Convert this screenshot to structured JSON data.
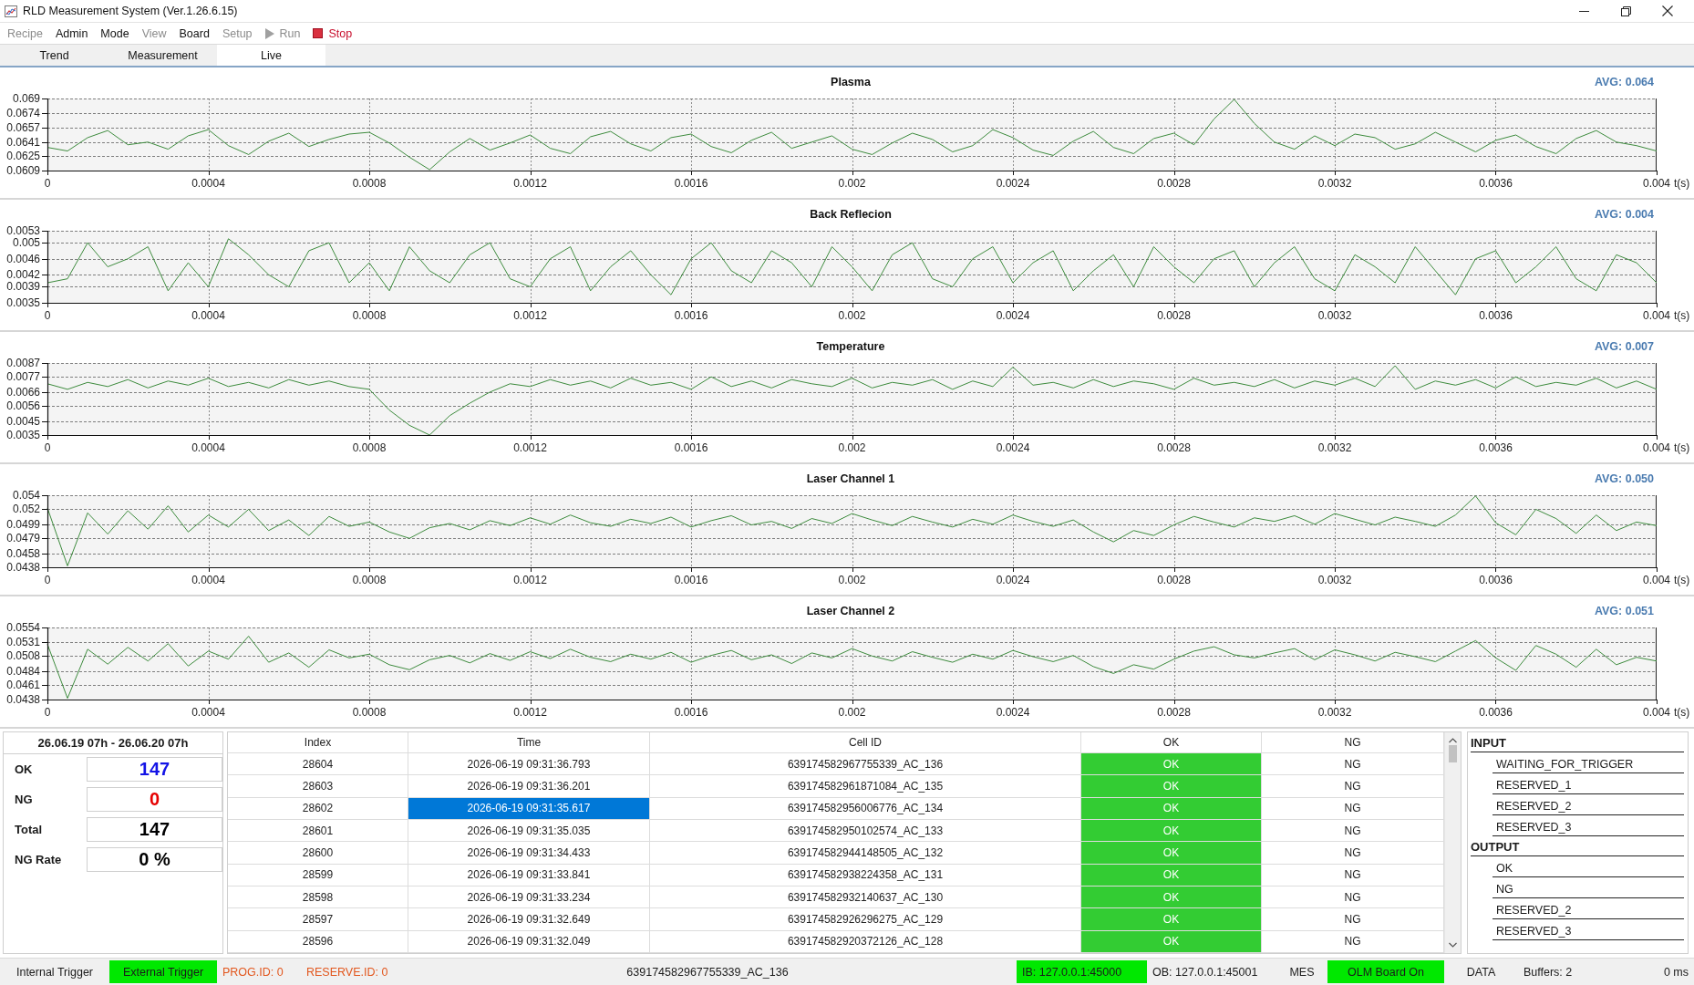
{
  "window": {
    "title": "RLD Measurement System (Ver.1.26.6.15)"
  },
  "menu": [
    {
      "label": "Recipe",
      "kind": "plain",
      "disabled": true
    },
    {
      "label": "Admin",
      "kind": "plain",
      "disabled": false
    },
    {
      "label": "Mode",
      "kind": "plain",
      "disabled": false
    },
    {
      "label": "View",
      "kind": "plain",
      "disabled": true
    },
    {
      "label": "Board",
      "kind": "plain",
      "disabled": false
    },
    {
      "label": "Setup",
      "kind": "plain",
      "disabled": true
    },
    {
      "label": "Run",
      "kind": "run",
      "disabled": true
    },
    {
      "label": "Stop",
      "kind": "stop",
      "disabled": false
    }
  ],
  "tabs": [
    {
      "label": "Trend",
      "selected": false
    },
    {
      "label": "Measurement",
      "selected": false
    },
    {
      "label": "Live",
      "selected": true
    }
  ],
  "charts": [
    {
      "average": "AVG: 0.064",
      "chart_data": {
        "type": "line",
        "title": "Plasma",
        "xlabel": "t(s)",
        "grid": true,
        "x": [
          0,
          5e-05,
          0.0001,
          0.00015,
          0.0002,
          0.00025,
          0.0003,
          0.00035,
          0.0004,
          0.00045,
          0.0005,
          0.00055,
          0.0006,
          0.00065,
          0.0007,
          0.00075,
          0.0008,
          0.00085,
          0.0009,
          0.00095,
          0.001,
          0.00105,
          0.0011,
          0.00115,
          0.0012,
          0.00125,
          0.0013,
          0.00135,
          0.0014,
          0.00145,
          0.0015,
          0.00155,
          0.0016,
          0.00165,
          0.0017,
          0.00175,
          0.0018,
          0.00185,
          0.0019,
          0.00195,
          0.002,
          0.00205,
          0.0021,
          0.00215,
          0.0022,
          0.00225,
          0.0023,
          0.00235,
          0.0024,
          0.00245,
          0.0025,
          0.00255,
          0.0026,
          0.00265,
          0.0027,
          0.00275,
          0.0028,
          0.00285,
          0.0029,
          0.00295,
          0.003,
          0.00305,
          0.0031,
          0.00315,
          0.0032,
          0.00325,
          0.0033,
          0.00335,
          0.0034,
          0.00345,
          0.0035,
          0.00355,
          0.0036,
          0.00365,
          0.0037,
          0.00375,
          0.0038,
          0.00385,
          0.0039,
          0.00395,
          0.004
        ],
        "values": [
          0.0635,
          0.0631,
          0.0646,
          0.0654,
          0.0638,
          0.0641,
          0.0633,
          0.0648,
          0.0655,
          0.0637,
          0.0627,
          0.0642,
          0.0651,
          0.0636,
          0.0644,
          0.065,
          0.0652,
          0.064,
          0.0624,
          0.061,
          0.063,
          0.0645,
          0.0632,
          0.064,
          0.0649,
          0.0634,
          0.0628,
          0.0647,
          0.0653,
          0.0639,
          0.0631,
          0.0646,
          0.065,
          0.0636,
          0.0629,
          0.0643,
          0.0652,
          0.0634,
          0.0641,
          0.0648,
          0.0633,
          0.0627,
          0.064,
          0.0651,
          0.0644,
          0.063,
          0.0637,
          0.0655,
          0.0646,
          0.0632,
          0.0626,
          0.0642,
          0.0653,
          0.0635,
          0.0628,
          0.0645,
          0.0651,
          0.0638,
          0.0667,
          0.0689,
          0.0662,
          0.0641,
          0.0633,
          0.0648,
          0.0637,
          0.065,
          0.0646,
          0.0633,
          0.0639,
          0.0652,
          0.0641,
          0.063,
          0.0643,
          0.0649,
          0.0636,
          0.0628,
          0.0645,
          0.0654,
          0.0641,
          0.0637,
          0.0631
        ],
        "xlim": [
          0,
          0.004
        ],
        "ylim": [
          0.0609,
          0.069
        ],
        "xticks": [
          0,
          0.0004,
          0.0008,
          0.0012,
          0.0016,
          0.002,
          0.0024,
          0.0028,
          0.0032,
          0.0036,
          0.004
        ],
        "yticks": [
          0.0609,
          0.0625,
          0.0641,
          0.0657,
          0.0674,
          0.069
        ]
      }
    },
    {
      "average": "AVG: 0.004",
      "chart_data": {
        "type": "line",
        "title": "Back Reflecion",
        "xlabel": "t(s)",
        "grid": true,
        "x": [
          0,
          5e-05,
          0.0001,
          0.00015,
          0.0002,
          0.00025,
          0.0003,
          0.00035,
          0.0004,
          0.00045,
          0.0005,
          0.00055,
          0.0006,
          0.00065,
          0.0007,
          0.00075,
          0.0008,
          0.00085,
          0.0009,
          0.00095,
          0.001,
          0.00105,
          0.0011,
          0.00115,
          0.0012,
          0.00125,
          0.0013,
          0.00135,
          0.0014,
          0.00145,
          0.0015,
          0.00155,
          0.0016,
          0.00165,
          0.0017,
          0.00175,
          0.0018,
          0.00185,
          0.0019,
          0.00195,
          0.002,
          0.00205,
          0.0021,
          0.00215,
          0.0022,
          0.00225,
          0.0023,
          0.00235,
          0.0024,
          0.00245,
          0.0025,
          0.00255,
          0.0026,
          0.00265,
          0.0027,
          0.00275,
          0.0028,
          0.00285,
          0.0029,
          0.00295,
          0.003,
          0.00305,
          0.0031,
          0.00315,
          0.0032,
          0.00325,
          0.0033,
          0.00335,
          0.0034,
          0.00345,
          0.0035,
          0.00355,
          0.0036,
          0.00365,
          0.0037,
          0.00375,
          0.0038,
          0.00385,
          0.0039,
          0.00395,
          0.004
        ],
        "values": [
          0.004,
          0.0041,
          0.005,
          0.0044,
          0.0046,
          0.0049,
          0.0038,
          0.0045,
          0.0039,
          0.0051,
          0.0047,
          0.0042,
          0.0039,
          0.0048,
          0.005,
          0.004,
          0.0045,
          0.0038,
          0.0049,
          0.0043,
          0.004,
          0.0047,
          0.005,
          0.0041,
          0.0039,
          0.0046,
          0.0049,
          0.0038,
          0.0044,
          0.0048,
          0.0042,
          0.0037,
          0.0046,
          0.005,
          0.0043,
          0.004,
          0.0048,
          0.0045,
          0.0039,
          0.0049,
          0.0044,
          0.0038,
          0.0047,
          0.005,
          0.0041,
          0.0039,
          0.0046,
          0.0049,
          0.004,
          0.0045,
          0.0048,
          0.0038,
          0.0043,
          0.0047,
          0.0039,
          0.0049,
          0.0044,
          0.004,
          0.0046,
          0.0048,
          0.0039,
          0.0045,
          0.0049,
          0.0041,
          0.0038,
          0.0047,
          0.0044,
          0.004,
          0.0049,
          0.0043,
          0.0037,
          0.0046,
          0.0048,
          0.004,
          0.0044,
          0.0049,
          0.0041,
          0.0038,
          0.0047,
          0.0045,
          0.004
        ],
        "xlim": [
          0,
          0.004
        ],
        "ylim": [
          0.0035,
          0.0053
        ],
        "xticks": [
          0,
          0.0004,
          0.0008,
          0.0012,
          0.0016,
          0.002,
          0.0024,
          0.0028,
          0.0032,
          0.0036,
          0.004
        ],
        "yticks": [
          0.0035,
          0.0039,
          0.0042,
          0.0046,
          0.005,
          0.0053
        ]
      }
    },
    {
      "average": "AVG: 0.007",
      "chart_data": {
        "type": "line",
        "title": "Temperature",
        "xlabel": "t(s)",
        "grid": true,
        "x": [
          0,
          5e-05,
          0.0001,
          0.00015,
          0.0002,
          0.00025,
          0.0003,
          0.00035,
          0.0004,
          0.00045,
          0.0005,
          0.00055,
          0.0006,
          0.00065,
          0.0007,
          0.00075,
          0.0008,
          0.00085,
          0.0009,
          0.00095,
          0.001,
          0.00105,
          0.0011,
          0.00115,
          0.0012,
          0.00125,
          0.0013,
          0.00135,
          0.0014,
          0.00145,
          0.0015,
          0.00155,
          0.0016,
          0.00165,
          0.0017,
          0.00175,
          0.0018,
          0.00185,
          0.0019,
          0.00195,
          0.002,
          0.00205,
          0.0021,
          0.00215,
          0.0022,
          0.00225,
          0.0023,
          0.00235,
          0.0024,
          0.00245,
          0.0025,
          0.00255,
          0.0026,
          0.00265,
          0.0027,
          0.00275,
          0.0028,
          0.00285,
          0.0029,
          0.00295,
          0.003,
          0.00305,
          0.0031,
          0.00315,
          0.0032,
          0.00325,
          0.0033,
          0.00335,
          0.0034,
          0.00345,
          0.0035,
          0.00355,
          0.0036,
          0.00365,
          0.0037,
          0.00375,
          0.0038,
          0.00385,
          0.0039,
          0.00395,
          0.004
        ],
        "values": [
          0.0072,
          0.0068,
          0.0073,
          0.007,
          0.0075,
          0.0069,
          0.0074,
          0.0071,
          0.0076,
          0.007,
          0.0073,
          0.0069,
          0.0075,
          0.0071,
          0.0074,
          0.007,
          0.0068,
          0.0053,
          0.0042,
          0.0035,
          0.0049,
          0.0058,
          0.0066,
          0.0072,
          0.007,
          0.0075,
          0.0071,
          0.0074,
          0.0069,
          0.0076,
          0.0071,
          0.0073,
          0.0068,
          0.0077,
          0.007,
          0.0074,
          0.0069,
          0.0075,
          0.0072,
          0.007,
          0.0076,
          0.0069,
          0.0073,
          0.0071,
          0.0075,
          0.0068,
          0.0074,
          0.007,
          0.0084,
          0.0071,
          0.0073,
          0.0069,
          0.0075,
          0.007,
          0.0074,
          0.0072,
          0.0068,
          0.0076,
          0.0071,
          0.0073,
          0.007,
          0.0075,
          0.0069,
          0.0074,
          0.0071,
          0.0076,
          0.007,
          0.0085,
          0.0068,
          0.0074,
          0.0071,
          0.0075,
          0.0069,
          0.0077,
          0.007,
          0.0073,
          0.0071,
          0.0076,
          0.0069,
          0.0074,
          0.0068
        ],
        "xlim": [
          0,
          0.004
        ],
        "ylim": [
          0.0035,
          0.0087
        ],
        "xticks": [
          0,
          0.0004,
          0.0008,
          0.0012,
          0.0016,
          0.002,
          0.0024,
          0.0028,
          0.0032,
          0.0036,
          0.004
        ],
        "yticks": [
          0.0035,
          0.0045,
          0.0056,
          0.0066,
          0.0077,
          0.0087
        ]
      }
    },
    {
      "average": "AVG: 0.050",
      "chart_data": {
        "type": "line",
        "title": "Laser Channel 1",
        "xlabel": "t(s)",
        "grid": true,
        "x": [
          0,
          5e-05,
          0.0001,
          0.00015,
          0.0002,
          0.00025,
          0.0003,
          0.00035,
          0.0004,
          0.00045,
          0.0005,
          0.00055,
          0.0006,
          0.00065,
          0.0007,
          0.00075,
          0.0008,
          0.00085,
          0.0009,
          0.00095,
          0.001,
          0.00105,
          0.0011,
          0.00115,
          0.0012,
          0.00125,
          0.0013,
          0.00135,
          0.0014,
          0.00145,
          0.0015,
          0.00155,
          0.0016,
          0.00165,
          0.0017,
          0.00175,
          0.0018,
          0.00185,
          0.0019,
          0.00195,
          0.002,
          0.00205,
          0.0021,
          0.00215,
          0.0022,
          0.00225,
          0.0023,
          0.00235,
          0.0024,
          0.00245,
          0.0025,
          0.00255,
          0.0026,
          0.00265,
          0.0027,
          0.00275,
          0.0028,
          0.00285,
          0.0029,
          0.00295,
          0.003,
          0.00305,
          0.0031,
          0.00315,
          0.0032,
          0.00325,
          0.0033,
          0.00335,
          0.0034,
          0.00345,
          0.0035,
          0.00355,
          0.0036,
          0.00365,
          0.0037,
          0.00375,
          0.0038,
          0.00385,
          0.0039,
          0.00395,
          0.004
        ],
        "values": [
          0.0522,
          0.044,
          0.0515,
          0.0485,
          0.0518,
          0.0492,
          0.0525,
          0.0488,
          0.0512,
          0.0495,
          0.052,
          0.049,
          0.0505,
          0.0483,
          0.051,
          0.0496,
          0.0502,
          0.0488,
          0.0479,
          0.0494,
          0.05,
          0.0491,
          0.0504,
          0.0497,
          0.0508,
          0.0499,
          0.0512,
          0.0501,
          0.0496,
          0.0506,
          0.05,
          0.0509,
          0.0495,
          0.0504,
          0.0511,
          0.0498,
          0.0503,
          0.0493,
          0.0507,
          0.05,
          0.0514,
          0.0505,
          0.0497,
          0.051,
          0.0502,
          0.0495,
          0.0506,
          0.0499,
          0.0512,
          0.0503,
          0.0496,
          0.0505,
          0.0488,
          0.0474,
          0.049,
          0.0483,
          0.0498,
          0.051,
          0.0502,
          0.0495,
          0.0508,
          0.0503,
          0.0511,
          0.0499,
          0.0514,
          0.0506,
          0.0498,
          0.0509,
          0.0503,
          0.0496,
          0.0512,
          0.0539,
          0.0501,
          0.0484,
          0.052,
          0.0507,
          0.0486,
          0.0512,
          0.049,
          0.0502,
          0.0497
        ],
        "xlim": [
          0,
          0.004
        ],
        "ylim": [
          0.0438,
          0.054
        ],
        "xticks": [
          0,
          0.0004,
          0.0008,
          0.0012,
          0.0016,
          0.002,
          0.0024,
          0.0028,
          0.0032,
          0.0036,
          0.004
        ],
        "yticks": [
          0.0438,
          0.0458,
          0.0479,
          0.0499,
          0.052,
          0.054
        ]
      }
    },
    {
      "average": "AVG: 0.051",
      "chart_data": {
        "type": "line",
        "title": "Laser Channel 2",
        "xlabel": "t(s)",
        "grid": true,
        "x": [
          0,
          5e-05,
          0.0001,
          0.00015,
          0.0002,
          0.00025,
          0.0003,
          0.00035,
          0.0004,
          0.00045,
          0.0005,
          0.00055,
          0.0006,
          0.00065,
          0.0007,
          0.00075,
          0.0008,
          0.00085,
          0.0009,
          0.00095,
          0.001,
          0.00105,
          0.0011,
          0.00115,
          0.0012,
          0.00125,
          0.0013,
          0.00135,
          0.0014,
          0.00145,
          0.0015,
          0.00155,
          0.0016,
          0.00165,
          0.0017,
          0.00175,
          0.0018,
          0.00185,
          0.0019,
          0.00195,
          0.002,
          0.00205,
          0.0021,
          0.00215,
          0.0022,
          0.00225,
          0.0023,
          0.00235,
          0.0024,
          0.00245,
          0.0025,
          0.00255,
          0.0026,
          0.00265,
          0.0027,
          0.00275,
          0.0028,
          0.00285,
          0.0029,
          0.00295,
          0.003,
          0.00305,
          0.0031,
          0.00315,
          0.0032,
          0.00325,
          0.0033,
          0.00335,
          0.0034,
          0.00345,
          0.0035,
          0.00355,
          0.0036,
          0.00365,
          0.0037,
          0.00375,
          0.0038,
          0.00385,
          0.0039,
          0.00395,
          0.004
        ],
        "values": [
          0.0527,
          0.044,
          0.0519,
          0.0495,
          0.0522,
          0.05,
          0.0528,
          0.0492,
          0.0516,
          0.0503,
          0.054,
          0.0498,
          0.0513,
          0.049,
          0.0518,
          0.0505,
          0.0511,
          0.0494,
          0.0486,
          0.0502,
          0.0509,
          0.0497,
          0.0512,
          0.0501,
          0.0515,
          0.0504,
          0.0519,
          0.0506,
          0.0499,
          0.0511,
          0.0503,
          0.0514,
          0.0498,
          0.0509,
          0.0517,
          0.0502,
          0.051,
          0.0496,
          0.0513,
          0.0505,
          0.052,
          0.0508,
          0.05,
          0.0515,
          0.0506,
          0.0498,
          0.0511,
          0.0503,
          0.0517,
          0.0507,
          0.0499,
          0.0509,
          0.0491,
          0.048,
          0.0494,
          0.0487,
          0.0503,
          0.0516,
          0.0523,
          0.051,
          0.0505,
          0.0513,
          0.052,
          0.0502,
          0.0518,
          0.051,
          0.05,
          0.0514,
          0.0507,
          0.0499,
          0.0516,
          0.0533,
          0.0505,
          0.0485,
          0.0525,
          0.0511,
          0.049,
          0.0519,
          0.0494,
          0.0506,
          0.05
        ],
        "xlim": [
          0,
          0.004
        ],
        "ylim": [
          0.0438,
          0.0554
        ],
        "xticks": [
          0,
          0.0004,
          0.0008,
          0.0012,
          0.0016,
          0.002,
          0.0024,
          0.0028,
          0.0032,
          0.0036,
          0.004
        ],
        "yticks": [
          0.0438,
          0.0461,
          0.0484,
          0.0508,
          0.0531,
          0.0554
        ]
      }
    }
  ],
  "summary": {
    "period": "26.06.19 07h - 26.06.20 07h",
    "rows": [
      {
        "label": "OK",
        "value": "147",
        "color": "#1414e6"
      },
      {
        "label": "NG",
        "value": "0",
        "color": "#e60000"
      },
      {
        "label": "Total",
        "value": "147",
        "color": "#000000"
      },
      {
        "label": "NG Rate",
        "value": "0 %",
        "color": "#000000"
      }
    ]
  },
  "table": {
    "columns": [
      "Index",
      "Time",
      "Cell ID",
      "OK",
      "NG"
    ],
    "rows": [
      {
        "index": "28604",
        "time": "2026-06-19 09:31:36.793",
        "cell_id": "639174582967755339_AC_136",
        "ok": "OK",
        "ng": "NG",
        "ok_on": true,
        "ng_on": false,
        "selected": false
      },
      {
        "index": "28603",
        "time": "2026-06-19 09:31:36.201",
        "cell_id": "639174582961871084_AC_135",
        "ok": "OK",
        "ng": "NG",
        "ok_on": true,
        "ng_on": false,
        "selected": false
      },
      {
        "index": "28602",
        "time": "2026-06-19 09:31:35.617",
        "cell_id": "639174582956006776_AC_134",
        "ok": "OK",
        "ng": "NG",
        "ok_on": true,
        "ng_on": false,
        "selected": true
      },
      {
        "index": "28601",
        "time": "2026-06-19 09:31:35.035",
        "cell_id": "639174582950102574_AC_133",
        "ok": "OK",
        "ng": "NG",
        "ok_on": true,
        "ng_on": false,
        "selected": false
      },
      {
        "index": "28600",
        "time": "2026-06-19 09:31:34.433",
        "cell_id": "639174582944148505_AC_132",
        "ok": "OK",
        "ng": "NG",
        "ok_on": true,
        "ng_on": false,
        "selected": false
      },
      {
        "index": "28599",
        "time": "2026-06-19 09:31:33.841",
        "cell_id": "639174582938224358_AC_131",
        "ok": "OK",
        "ng": "NG",
        "ok_on": true,
        "ng_on": false,
        "selected": false
      },
      {
        "index": "28598",
        "time": "2026-06-19 09:31:33.234",
        "cell_id": "639174582932140637_AC_130",
        "ok": "OK",
        "ng": "NG",
        "ok_on": true,
        "ng_on": false,
        "selected": false
      },
      {
        "index": "28597",
        "time": "2026-06-19 09:31:32.649",
        "cell_id": "639174582926296275_AC_129",
        "ok": "OK",
        "ng": "NG",
        "ok_on": true,
        "ng_on": false,
        "selected": false
      },
      {
        "index": "28596",
        "time": "2026-06-19 09:31:32.049",
        "cell_id": "639174582920372126_AC_128",
        "ok": "OK",
        "ng": "NG",
        "ok_on": true,
        "ng_on": false,
        "selected": false
      }
    ]
  },
  "io_panel": [
    {
      "title": "INPUT",
      "items": [
        "WAITING_FOR_TRIGGER",
        "RESERVED_1",
        "RESERVED_2",
        "RESERVED_3"
      ]
    },
    {
      "title": "OUTPUT",
      "items": [
        "OK",
        "NG",
        "RESERVED_2",
        "RESERVED_3"
      ]
    }
  ],
  "status_bar": [
    {
      "label": "Internal Trigger",
      "kind": "indicator",
      "on": false
    },
    {
      "label": "External Trigger",
      "kind": "indicator",
      "on": true
    },
    {
      "label": "PROG.ID: 0",
      "kind": "id"
    },
    {
      "label": "RESERVE.ID: 0",
      "kind": "id"
    },
    {
      "label": "639174582967755339_AC_136",
      "kind": "text"
    },
    {
      "label": "IB: 127.0.0.1:45000",
      "kind": "indicator",
      "on": true
    },
    {
      "label": "OB: 127.0.0.1:45001",
      "kind": "indicator",
      "on": false
    },
    {
      "label": "MES",
      "kind": "indicator",
      "on": false
    },
    {
      "label": "OLM Board On",
      "kind": "indicator",
      "on": true
    },
    {
      "label": "DATA",
      "kind": "indicator",
      "on": false
    },
    {
      "label": "Buffers: 2",
      "kind": "text"
    },
    {
      "label": "0 ms",
      "kind": "text"
    }
  ]
}
